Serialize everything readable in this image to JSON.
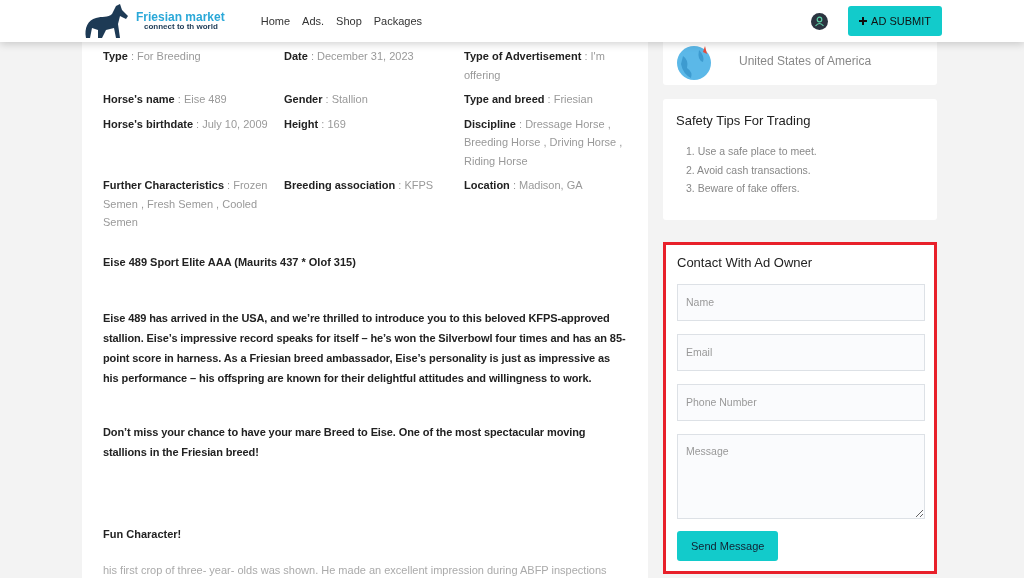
{
  "header": {
    "logo_title": "Friesian market",
    "logo_tagline": "connect to th world",
    "nav": [
      {
        "label": "Home"
      },
      {
        "label": "Ads."
      },
      {
        "label": "Shop"
      },
      {
        "label": "Packages"
      }
    ],
    "submit_button": "AD SUBMIT"
  },
  "details": [
    {
      "label": "Type",
      "value": ": For Breeding"
    },
    {
      "label": "Date",
      "value": ": December 31, 2023"
    },
    {
      "label": "Type of Advertisement",
      "value": ": I'm offering"
    },
    {
      "label": "Horse's name",
      "value": ": Eise 489"
    },
    {
      "label": "Gender",
      "value": ": Stallion"
    },
    {
      "label": "Type and breed",
      "value": ": Friesian"
    },
    {
      "label": "Horse's birthdate",
      "value": ": July 10, 2009"
    },
    {
      "label": "Height",
      "value": ": 169"
    },
    {
      "label": "Discipline",
      "value": ": Dressage Horse , Breeding Horse , Driving Horse , Riding Horse"
    },
    {
      "label": "Further Characteristics",
      "value": ": Frozen Semen , Fresh Semen , Cooled Semen"
    },
    {
      "label": "Breeding association",
      "value": ": KFPS"
    },
    {
      "label": "Location",
      "value": ": Madison, GA"
    }
  ],
  "description": [
    {
      "kind": "heading",
      "text": "Eise 489 Sport Elite AAA (Maurits 437 * Olof 315)"
    },
    {
      "kind": "paragraph",
      "text": "Eise 489 has arrived in the USA, and we’re thrilled to introduce you to this beloved KFPS-approved stallion. Eise’s impressive record speaks for itself – he’s won the Silverbowl four times and has an 85-point score in harness. As a Friesian breed ambassador, Eise’s personality is just as impressive as his performance – his offspring are known for their delightful attitudes and willingness to work."
    },
    {
      "kind": "paragraph",
      "text": "Don’t miss your chance to have your mare Breed to Eise. One of the most spectacular moving stallions in the Friesian breed!"
    },
    {
      "kind": "heading",
      "text": "Fun Character!"
    },
    {
      "kind": "muted",
      "text": "his first crop of three- year- olds was shown. He made an excellent impression during ABFP inspections"
    }
  ],
  "country": "United States of America",
  "safety": {
    "title": "Safety Tips For Trading",
    "tips": [
      "1. Use a safe place to meet.",
      "2. Avoid cash transactions.",
      "3. Beware of fake offers."
    ]
  },
  "contact": {
    "title": "Contact With Ad Owner",
    "fields": [
      {
        "kind": "input",
        "placeholder": "Name"
      },
      {
        "kind": "input",
        "placeholder": "Email"
      },
      {
        "kind": "input",
        "placeholder": "Phone Number"
      },
      {
        "kind": "textarea",
        "placeholder": "Message"
      }
    ],
    "button": "Send Message"
  }
}
